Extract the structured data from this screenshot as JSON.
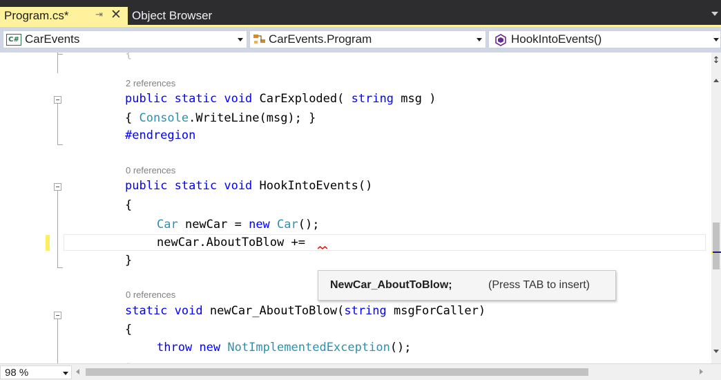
{
  "tabs": [
    {
      "label": "Program.cs*",
      "active": true
    },
    {
      "label": "Object Browser",
      "active": false
    }
  ],
  "navbar": {
    "project": "CarEvents",
    "type": "CarEvents.Program",
    "member": "HookIntoEvents()"
  },
  "code": {
    "lens_car_exploded": "2 references",
    "line_car_exploded_sig": [
      "public",
      "static",
      "void",
      "CarExploded(",
      "string",
      "msg )"
    ],
    "line_car_exploded_body": [
      "{ ",
      "Console",
      ".WriteLine(msg); }"
    ],
    "line_endregion": "#endregion",
    "lens_hook": "0 references",
    "line_hook_sig": [
      "public",
      "static",
      "void",
      "HookIntoEvents()"
    ],
    "brace_open": "{",
    "line_new_car": [
      "Car",
      " newCar = ",
      "new",
      " ",
      "Car",
      "();"
    ],
    "line_about_to_blow": "newCar.AboutToBlow +=",
    "brace_close": "}",
    "lens_handler": "0 references",
    "line_handler_sig": [
      "static",
      "void",
      "newCar_AboutToBlow(",
      "string",
      "msgForCaller)"
    ],
    "line_throw": [
      "throw",
      "new",
      "NotImplementedException",
      "();"
    ]
  },
  "intellisense": {
    "suggestion": "NewCar_AboutToBlow;",
    "hint": "(Press TAB to insert)"
  },
  "statusbar": {
    "zoom": "98 %"
  },
  "colors": {
    "keyword": "#0000ff",
    "type": "#2b91af",
    "tab_active": "#fff29d",
    "modified_marker": "#ffee62",
    "error_squiggle": "#e51400"
  }
}
